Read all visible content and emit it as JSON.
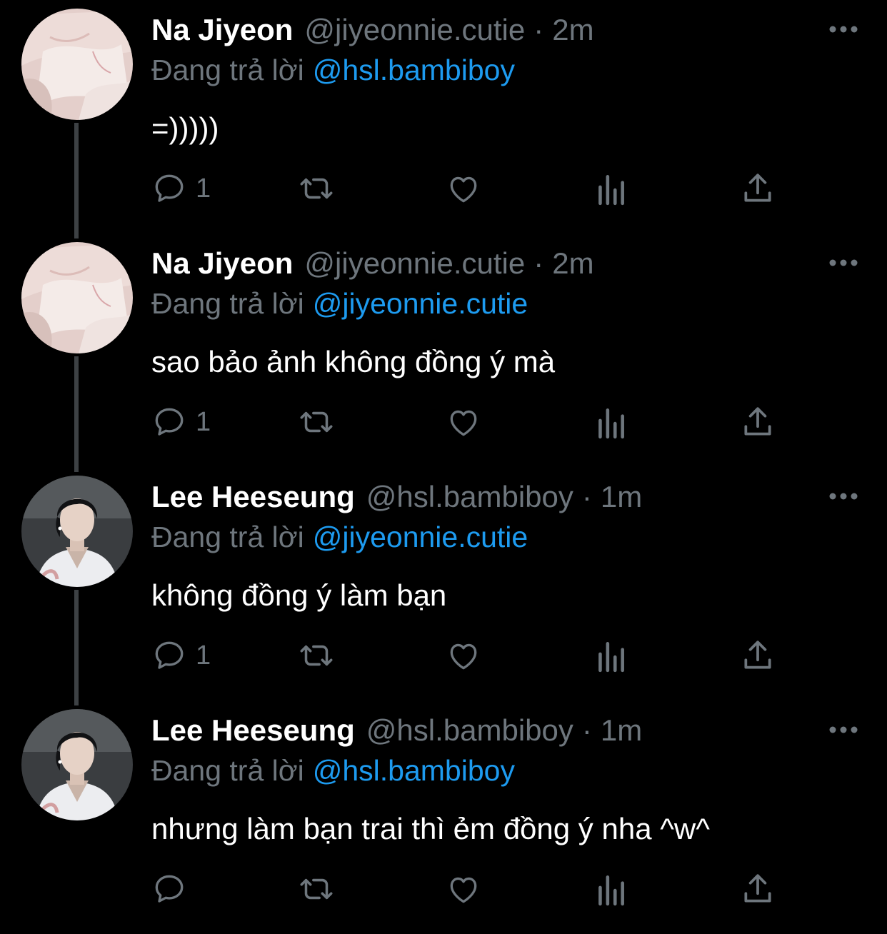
{
  "theme": {
    "background": "#000000",
    "text_primary": "#ffffff",
    "text_secondary": "#6e767d",
    "accent": "#1d9bf0",
    "thread_line": "#3d4144"
  },
  "tweets": [
    {
      "author_name": "Na Jiyeon",
      "handle": "@jiyeonnie.cutie",
      "separator": "·",
      "time": "2m",
      "reply_prefix": "Đang trả lời",
      "reply_to": "@hsl.bambiboy",
      "text": "=)))))",
      "reply_count": "1",
      "avatar": "pink-fabric-avatar",
      "icons": [
        "reply-icon",
        "retweet-icon",
        "like-icon",
        "analytics-icon",
        "share-icon",
        "more-icon"
      ]
    },
    {
      "author_name": "Na Jiyeon",
      "handle": "@jiyeonnie.cutie",
      "separator": "·",
      "time": "2m",
      "reply_prefix": "Đang trả lời",
      "reply_to": "@jiyeonnie.cutie",
      "text": "sao bảo ảnh không đồng ý mà",
      "reply_count": "1",
      "avatar": "pink-fabric-avatar",
      "icons": [
        "reply-icon",
        "retweet-icon",
        "like-icon",
        "analytics-icon",
        "share-icon",
        "more-icon"
      ]
    },
    {
      "author_name": "Lee Heeseung",
      "handle": "@hsl.bambiboy",
      "separator": "·",
      "time": "1m",
      "reply_prefix": "Đang trả lời",
      "reply_to": "@jiyeonnie.cutie",
      "text": "không đồng ý làm bạn",
      "reply_count": "1",
      "avatar": "man-white-shirt-avatar",
      "icons": [
        "reply-icon",
        "retweet-icon",
        "like-icon",
        "analytics-icon",
        "share-icon",
        "more-icon"
      ]
    },
    {
      "author_name": "Lee Heeseung",
      "handle": "@hsl.bambiboy",
      "separator": "·",
      "time": "1m",
      "reply_prefix": "Đang trả lời",
      "reply_to": "@hsl.bambiboy",
      "text": "nhưng làm bạn trai thì ẻm đồng ý nha ^w^",
      "reply_count": "",
      "avatar": "man-white-shirt-avatar",
      "icons": [
        "reply-icon",
        "retweet-icon",
        "like-icon",
        "analytics-icon",
        "share-icon",
        "more-icon"
      ]
    }
  ]
}
